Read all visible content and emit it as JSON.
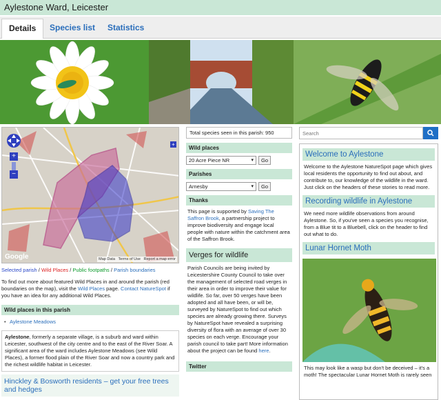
{
  "header": {
    "title": "Aylestone Ward, Leicester"
  },
  "tabs": [
    {
      "label": "Details"
    },
    {
      "label": "Species list"
    },
    {
      "label": "Statistics"
    }
  ],
  "map": {
    "google_label": "Google",
    "footer": [
      "Map Data",
      "Terms of Use",
      "Report a map error"
    ]
  },
  "legend": {
    "selected": "Selected parish",
    "sep1": " / ",
    "wild": "Wild Places",
    "sep2": " / ",
    "footpaths": "Public footpaths",
    "sep3": " / ",
    "boundaries": "Parish boundaries"
  },
  "left": {
    "info_a": "To find out more about featured Wild Places in and around the parish (red boundaries on the map), visit the ",
    "info_link1": "Wild Places",
    "info_b": " page. ",
    "info_link2": "Contact NatureSpot",
    "info_c": " if you have an idea for any additional Wild Places.",
    "wild_heading": "Wild places in this parish",
    "wild_items": [
      "Aylestone Meadows"
    ],
    "desc_bold": "Aylestone",
    "desc_rest": ", formerly a separate village, is a suburb and ward within Leicester, southwest of the city centre and to the east of the River Soar. A significant area of the ward includes Aylestone Meadows (see Wild Places), a former flood plain of the River Soar and now a country park and the richest wildlife habitat in Leicester.",
    "promo": "Hinckley & Bosworth residents – get your free trees and hedges"
  },
  "middle": {
    "total_species": "Total species seen in this parish: 950",
    "wild_heading": "Wild places",
    "wild_select": "20 Acre Piece NR",
    "go": "Go",
    "parishes_heading": "Parishes",
    "parish_select": "Arnesby",
    "thanks_heading": "Thanks",
    "thanks_a": "This page is supported by ",
    "thanks_link": "Saving The Saffron Brook",
    "thanks_b": ", a partnership project to improve biodiversity and engage local people with nature within the catchment area of the Saffron Brook.",
    "verges_heading": "Verges for wildlife",
    "verges_a": "Parish Councils are being invited by Leicestershire County Council to take over the management of selected road verges in their area in order to improve their value for wildlife. So far, over 50 verges have been adopted and all have been, or will be, surveyed by NatureSpot to find out which species are already growing there. Surveys by NatureSpot have revealed a surprising diversity of flora with an average of over 30 species on each verge. Encourage your parish council to take part! More information about the project can be found ",
    "verges_link": "here",
    "verges_b": ".",
    "twitter_heading": "Twitter"
  },
  "right": {
    "search_placeholder": "Search",
    "welcome_heading": "Welcome to Aylestone",
    "welcome_text": "Welcome to the Aylestone NatureSpot page which gives local residents the opportunity to find out about, and contribute to, our knowledge of the wildlife in the ward. Just click on the headers of these stories to read more.",
    "recording_heading": "Recording wildlife in Aylestone",
    "recording_text": "We need more wildlife observations from around Aylestone. So, if you've seen a species you recognise, from a Blue tit to a Bluebell, click on the header to find out what to do.",
    "moth_heading": "Lunar Hornet Moth",
    "moth_text": "This may look like a wasp but don't be deceived – it's a moth! The spectacular Lunar Hornet Moth is rarely seen"
  },
  "colors": {
    "accent_green": "#c9e7d6",
    "link_blue": "#2a6ebb",
    "search_button": "#1f6fc6",
    "selected_parish": "#3535c8",
    "wild_places": "#d04848"
  },
  "icons": [
    "search-icon",
    "pan-arrows-icon",
    "zoom-in-icon",
    "zoom-out-icon",
    "select-arrow-icon"
  ]
}
